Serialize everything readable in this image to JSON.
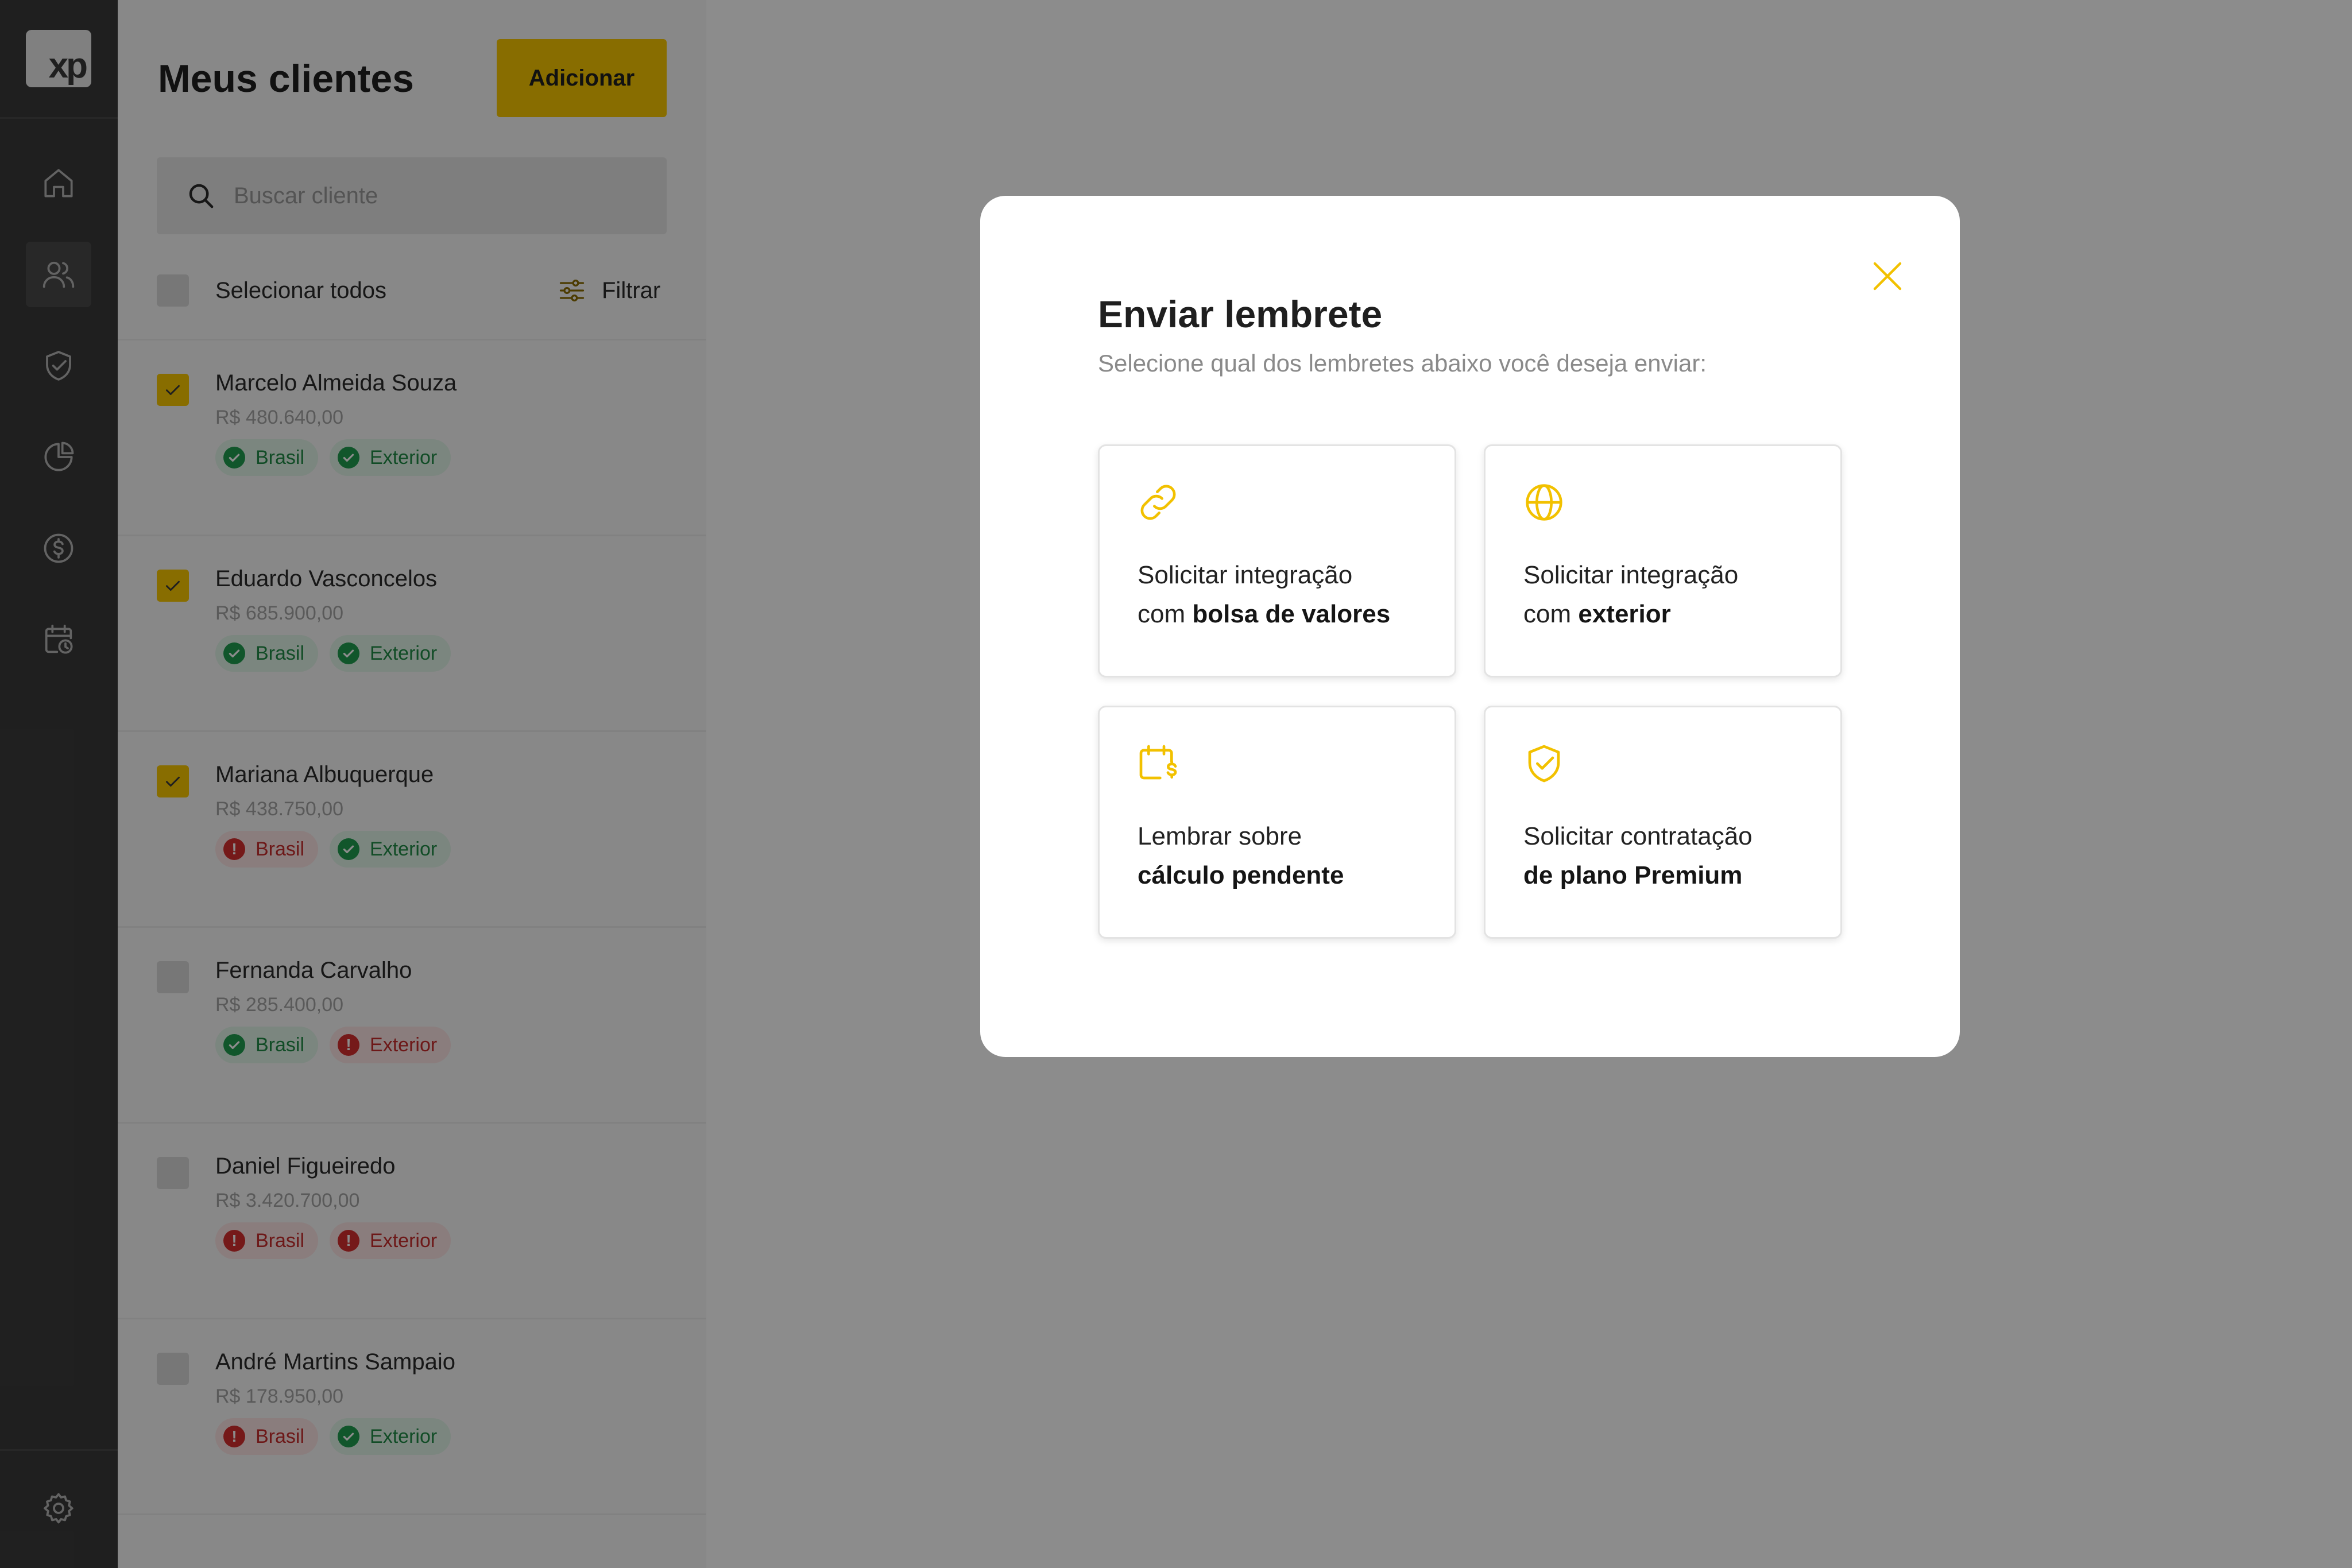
{
  "brand": {
    "logo_text": "xp",
    "accent": "#F7C600",
    "ok": "#1F9D4F",
    "error": "#D62F2F"
  },
  "rail": {
    "items": [
      {
        "name": "home",
        "icon": "home-icon",
        "active": false
      },
      {
        "name": "clients",
        "icon": "users-icon",
        "active": true
      },
      {
        "name": "security",
        "icon": "shield-check-icon",
        "active": false
      },
      {
        "name": "reports",
        "icon": "pie-chart-icon",
        "active": false
      },
      {
        "name": "finance",
        "icon": "dollar-circle-icon",
        "active": false
      },
      {
        "name": "schedule",
        "icon": "calendar-clock-icon",
        "active": false
      }
    ],
    "settings_icon": "gear-icon"
  },
  "panel": {
    "title": "Meus clientes",
    "add_label": "Adicionar",
    "search_placeholder": "Buscar cliente",
    "select_all_label": "Selecionar todos",
    "filter_label": "Filtrar",
    "clients": [
      {
        "name": "Marcelo Almeida Souza",
        "value": "R$ 480.640,00",
        "checked": true,
        "tags": [
          {
            "label": "Brasil",
            "status": "ok"
          },
          {
            "label": "Exterior",
            "status": "ok"
          }
        ]
      },
      {
        "name": "Eduardo Vasconcelos",
        "value": "R$ 685.900,00",
        "checked": true,
        "tags": [
          {
            "label": "Brasil",
            "status": "ok"
          },
          {
            "label": "Exterior",
            "status": "ok"
          }
        ]
      },
      {
        "name": "Mariana Albuquerque",
        "value": "R$ 438.750,00",
        "checked": true,
        "tags": [
          {
            "label": "Brasil",
            "status": "err"
          },
          {
            "label": "Exterior",
            "status": "ok"
          }
        ]
      },
      {
        "name": "Fernanda Carvalho",
        "value": "R$ 285.400,00",
        "checked": false,
        "tags": [
          {
            "label": "Brasil",
            "status": "ok"
          },
          {
            "label": "Exterior",
            "status": "err"
          }
        ]
      },
      {
        "name": "Daniel Figueiredo",
        "value": "R$ 3.420.700,00",
        "checked": false,
        "tags": [
          {
            "label": "Brasil",
            "status": "err"
          },
          {
            "label": "Exterior",
            "status": "err"
          }
        ]
      },
      {
        "name": "André Martins Sampaio",
        "value": "R$ 178.950,00",
        "checked": false,
        "tags": [
          {
            "label": "Brasil",
            "status": "err"
          },
          {
            "label": "Exterior",
            "status": "ok"
          }
        ]
      }
    ]
  },
  "modal": {
    "title": "Enviar lembrete",
    "subtitle": "Selecione qual dos lembretes abaixo você deseja enviar:",
    "options": [
      {
        "icon": "link-icon",
        "line1": "Solicitar integração",
        "line2_prefix": "com ",
        "line2_bold": "bolsa de valores"
      },
      {
        "icon": "globe-icon",
        "line1": "Solicitar integração",
        "line2_prefix": "com ",
        "line2_bold": "exterior"
      },
      {
        "icon": "calendar-dollar-icon",
        "line1": "Lembrar sobre",
        "line2_prefix": "",
        "line2_bold": "cálculo pendente"
      },
      {
        "icon": "shield-check-icon",
        "line1": "Solicitar contratação",
        "line2_prefix": "",
        "line2_bold": "de plano Premium"
      }
    ]
  }
}
